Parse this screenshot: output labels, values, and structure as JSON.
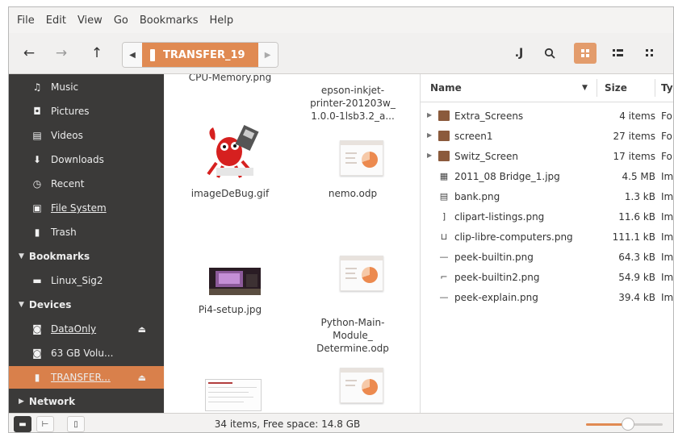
{
  "colors": {
    "accent": "#e08a52",
    "sidebar_bg": "#3b3a39",
    "folder": "#8b5a3c"
  },
  "menu": [
    "File",
    "Edit",
    "View",
    "Go",
    "Bookmarks",
    "Help"
  ],
  "toolbar": {
    "back_icon": "back-arrow-icon",
    "forward_icon": "forward-arrow-icon",
    "up_icon": "up-arrow-icon",
    "path_crumb": "TRANSFER_19",
    "icons": [
      "open-terminal-icon",
      "search-icon",
      "grid-view-icon",
      "compact-list-icon",
      "list-view-icon"
    ],
    "active_view": "grid-view-icon"
  },
  "sidebar": {
    "items": [
      {
        "label": "Music",
        "icon": "music-icon"
      },
      {
        "label": "Pictures",
        "icon": "pictures-icon"
      },
      {
        "label": "Videos",
        "icon": "videos-icon"
      },
      {
        "label": "Downloads",
        "icon": "downloads-icon"
      },
      {
        "label": "Recent",
        "icon": "recent-icon"
      },
      {
        "label": "File System",
        "icon": "filesystem-icon"
      },
      {
        "label": "Trash",
        "icon": "trash-icon"
      }
    ],
    "bookmarks_header": "Bookmarks",
    "bookmarks": [
      {
        "label": "Linux_Sig2",
        "icon": "folder-icon"
      }
    ],
    "devices_header": "Devices",
    "devices": [
      {
        "label": "DataOnly",
        "icon": "drive-icon"
      },
      {
        "label": "63 GB Volu...",
        "icon": "drive-icon"
      },
      {
        "label": "TRANSFER...",
        "icon": "usb-drive-icon"
      }
    ],
    "network_header": "Network"
  },
  "grid": {
    "items": [
      {
        "label": "CPU-Memory.png"
      },
      {
        "label": "epson-inkjet-\nprinter-201203w_\n1.0.0-1lsb3.2_a..."
      },
      {
        "label": "imageDeBug.gif"
      },
      {
        "label": "nemo.odp"
      },
      {
        "label": "Pi4-setup.jpg"
      },
      {
        "label": "Python-Main-\nModule_\nDetermine.odp"
      }
    ]
  },
  "list": {
    "columns": {
      "name": "Name",
      "size": "Size",
      "type": "Ty"
    },
    "rows": [
      {
        "name": "Extra_Screens",
        "size": "4 items",
        "type": "Fo",
        "icon": "folder-icon",
        "expandable": true
      },
      {
        "name": "screen1",
        "size": "27 items",
        "type": "Fo",
        "icon": "folder-icon",
        "expandable": true
      },
      {
        "name": "Switz_Screen",
        "size": "17 items",
        "type": "Fo",
        "icon": "folder-icon",
        "expandable": true
      },
      {
        "name": "2011_08 Bridge_1.jpg",
        "size": "4.5 MB",
        "type": "Im",
        "icon": "image-file-icon"
      },
      {
        "name": "bank.png",
        "size": "1.3 kB",
        "type": "Im",
        "icon": "image-file-icon"
      },
      {
        "name": "clipart-listings.png",
        "size": "11.6 kB",
        "type": "Im",
        "icon": "image-file-icon"
      },
      {
        "name": "clip-libre-computers.png",
        "size": "111.1 kB",
        "type": "Im",
        "icon": "image-file-icon"
      },
      {
        "name": "peek-builtin.png",
        "size": "64.3 kB",
        "type": "Im",
        "icon": "image-file-icon"
      },
      {
        "name": "peek-builtin2.png",
        "size": "54.9 kB",
        "type": "Im",
        "icon": "image-file-icon"
      },
      {
        "name": "peek-explain.png",
        "size": "39.4 kB",
        "type": "Im",
        "icon": "image-file-icon"
      }
    ]
  },
  "status": {
    "text": "34 items, Free space: 14.8 GB",
    "zoom_level": 0.55
  }
}
